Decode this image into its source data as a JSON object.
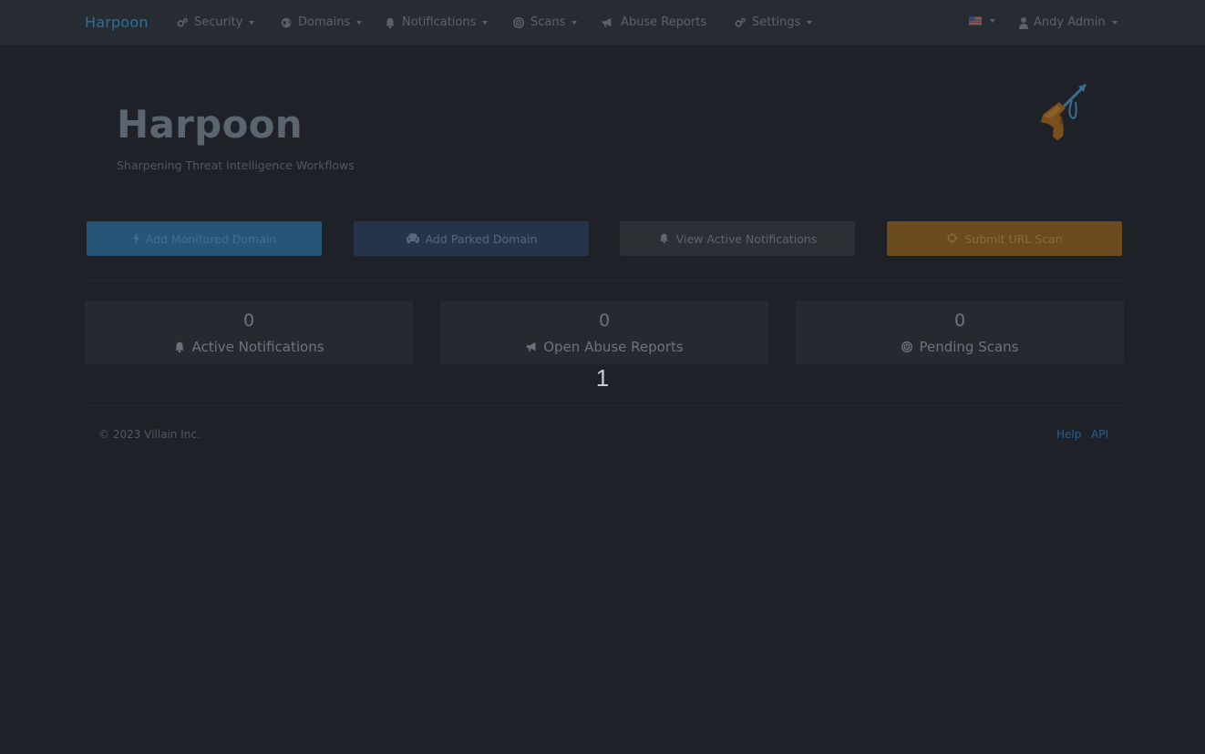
{
  "navbar": {
    "brand": "Harpoon",
    "items": [
      {
        "label": "Security",
        "icon": "cogs-icon"
      },
      {
        "label": "Domains",
        "icon": "globe-icon"
      },
      {
        "label": "Notifications",
        "icon": "bell-icon"
      },
      {
        "label": "Scans",
        "icon": "bullseye-icon"
      },
      {
        "label": "Abuse Reports",
        "icon": "bullhorn-icon"
      },
      {
        "label": "Settings",
        "icon": "cogs-icon"
      }
    ],
    "language_icon": "us-flag-icon",
    "user": {
      "label": "Andy Admin",
      "icon": "user-icon"
    }
  },
  "header": {
    "title": "Harpoon",
    "subtitle": "Sharpening Threat Intelligence Workflows",
    "logo_icon": "harpoon-gun-logo"
  },
  "actions": [
    {
      "label": "Add Monitored Domain",
      "icon": "bolt-icon",
      "color": "#255678"
    },
    {
      "label": "Add Parked Domain",
      "icon": "car-icon",
      "color": "#24344a"
    },
    {
      "label": "View Active Notifications",
      "icon": "bell-icon",
      "color": "#2c2f34"
    },
    {
      "label": "Submit URL Scan",
      "icon": "crosshairs-icon",
      "color": "#6b4a1d"
    }
  ],
  "stats": [
    {
      "count": "0",
      "label": "Active Notifications",
      "icon": "bell-icon"
    },
    {
      "count": "0",
      "label": "Open Abuse Reports",
      "icon": "bullhorn-icon"
    },
    {
      "count": "0",
      "label": "Pending Scans",
      "icon": "bullseye-icon"
    }
  ],
  "pagination": {
    "current_page": "1"
  },
  "footer": {
    "copyright": "© 2023 Villain Inc.",
    "links": [
      "Help",
      "API"
    ]
  },
  "colors": {
    "background": "#1e2128",
    "navbar": "#272c33",
    "brand": "#2f6f98",
    "link": "#2f5f85"
  }
}
